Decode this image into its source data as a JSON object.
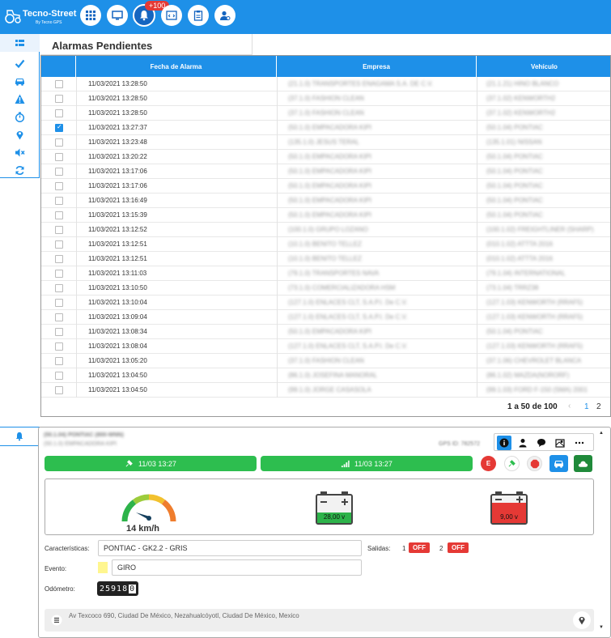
{
  "app": {
    "brand": "Tecno-Street",
    "brand_sub": "By Tecno GPS",
    "notification_count": "+100"
  },
  "nav": {
    "icons": [
      "apps-grid-icon",
      "monitor-icon",
      "bell-icon",
      "code-window-icon",
      "clipboard-icon",
      "user-settings-icon"
    ],
    "active": "bell-icon"
  },
  "sidebar": {
    "icons": [
      "list-icon",
      "check-icon",
      "car-icon",
      "warning-icon",
      "stopwatch-icon",
      "map-pin-icon",
      "mute-icon",
      "refresh-icon"
    ]
  },
  "panel": {
    "title": "Alarmas Pendientes"
  },
  "table": {
    "columns": [
      "Fecha de Alarma",
      "Empresa",
      "Vehículo"
    ],
    "rows": [
      {
        "checked": false,
        "date": "11/03/2021 13:28:50",
        "empresa": "(21.1.0) TRANSPORTES ENAGAMA S.A. DE C.V.",
        "vehiculo": "(21.1.21) HINO BLANCO"
      },
      {
        "checked": false,
        "date": "11/03/2021 13:28:50",
        "empresa": "(37.1.0) FASHION CLEAN",
        "vehiculo": "(37.1.02) KENWORTH2"
      },
      {
        "checked": false,
        "date": "11/03/2021 13:28:50",
        "empresa": "(37.1.0) FASHION CLEAN",
        "vehiculo": "(37.1.02) KENWORTH2"
      },
      {
        "checked": true,
        "date": "11/03/2021 13:27:37",
        "empresa": "(50.1.0) EMPACADORA KIPI",
        "vehiculo": "(50.1.04) PONTIAC"
      },
      {
        "checked": false,
        "date": "11/03/2021 13:23:48",
        "empresa": "(135.1.0) JESUS TERAL",
        "vehiculo": "(135.1.01) NISSAN"
      },
      {
        "checked": false,
        "date": "11/03/2021 13:20:22",
        "empresa": "(50.1.0) EMPACADORA KIPI",
        "vehiculo": "(50.1.04) PONTIAC"
      },
      {
        "checked": false,
        "date": "11/03/2021 13:17:06",
        "empresa": "(50.1.0) EMPACADORA KIPI",
        "vehiculo": "(50.1.04) PONTIAC"
      },
      {
        "checked": false,
        "date": "11/03/2021 13:17:06",
        "empresa": "(50.1.0) EMPACADORA KIPI",
        "vehiculo": "(50.1.04) PONTIAC"
      },
      {
        "checked": false,
        "date": "11/03/2021 13:16:49",
        "empresa": "(50.1.0) EMPACADORA KIPI",
        "vehiculo": "(50.1.04) PONTIAC"
      },
      {
        "checked": false,
        "date": "11/03/2021 13:15:39",
        "empresa": "(50.1.0) EMPACADORA KIPI",
        "vehiculo": "(50.1.04) PONTIAC"
      },
      {
        "checked": false,
        "date": "11/03/2021 13:12:52",
        "empresa": "(100.1.0) GRUPO LOZANO",
        "vehiculo": "(100.1.02) FREIGHTLINER (SHARP)"
      },
      {
        "checked": false,
        "date": "11/03/2021 13:12:51",
        "empresa": "(10.1.0) BENITO TELLEZ",
        "vehiculo": "(010.1.02) ATTTA 2016"
      },
      {
        "checked": false,
        "date": "11/03/2021 13:12:51",
        "empresa": "(10.1.0) BENITO TELLEZ",
        "vehiculo": "(010.1.02) ATTTA 2016"
      },
      {
        "checked": false,
        "date": "11/03/2021 13:11:03",
        "empresa": "(79.1.0) TRANSPORTES NAVA",
        "vehiculo": "(79.1.04) INTERNATIONAL"
      },
      {
        "checked": false,
        "date": "11/03/2021 13:10:50",
        "empresa": "(73.1.0) COMERCIALIZADORA HSM",
        "vehiculo": "(73.1.04) TRRZ38"
      },
      {
        "checked": false,
        "date": "11/03/2021 13:10:04",
        "empresa": "(127.1.0) ENLACES CLT, S.A.P.I. De C.V.",
        "vehiculo": "(127.1.03) KENWORTH (RRAF5)"
      },
      {
        "checked": false,
        "date": "11/03/2021 13:09:04",
        "empresa": "(127.1.0) ENLACES CLT, S.A.P.I. De C.V.",
        "vehiculo": "(127.1.03) KENWORTH (RRAF5)"
      },
      {
        "checked": false,
        "date": "11/03/2021 13:08:34",
        "empresa": "(50.1.0) EMPACADORA KIPI",
        "vehiculo": "(50.1.04) PONTIAC"
      },
      {
        "checked": false,
        "date": "11/03/2021 13:08:04",
        "empresa": "(127.1.0) ENLACES CLT, S.A.P.I. De C.V.",
        "vehiculo": "(127.1.03) KENWORTH (RRAF5)"
      },
      {
        "checked": false,
        "date": "11/03/2021 13:05:20",
        "empresa": "(37.1.0) FASHION CLEAN",
        "vehiculo": "(37.1.06) CHEVROLET BLANCA"
      },
      {
        "checked": false,
        "date": "11/03/2021 13:04:50",
        "empresa": "(86.1.0) JOSEFINA MANORAL",
        "vehiculo": "(86.1.02) MAZDA(NORORF)"
      },
      {
        "checked": false,
        "date": "11/03/2021 13:04:50",
        "empresa": "(99.1.0) JORGE CASASOLA",
        "vehiculo": "(99.1.03) FORD F-150 (SMA) 2001"
      }
    ]
  },
  "pager": {
    "info": "1 a 50 de 100",
    "prev": "‹",
    "pages": [
      "1",
      "2"
    ]
  },
  "detail": {
    "vehicle_title": "(50.1.04) PONTIAC (800-WNN)",
    "company": "(50.1.0) EMPACADORA KIPI",
    "gps_id": "GPS ID: 782572",
    "gps_time": "11/03 13:27",
    "signal_time": "11/03 13:27",
    "speed": "14 km/h",
    "speed_value": 14,
    "battery1": "28,00 v",
    "battery2": "9,00 v",
    "battery_colors": {
      "ok": "#2db34a",
      "low": "#e53935"
    },
    "labels": {
      "caracteristicas": "Características:",
      "evento": "Evento:",
      "odometro": "Odómetro:",
      "salidas": "Salidas:"
    },
    "caracteristicas_value": "PONTIAC - GK2.2 - GRIS",
    "evento_value": "GIRO",
    "salidas": [
      {
        "num": "1",
        "state": "OFF"
      },
      {
        "num": "2",
        "state": "OFF"
      }
    ],
    "odometer_digits": "25918",
    "odometer_last": "0",
    "address": "Av Texcoco 690, Ciudad De México, Nezahualcóyotl, Ciudad De México, Mexico"
  },
  "colors": {
    "primary": "#1e90e8",
    "green": "#2dbe4f",
    "red": "#e53935"
  }
}
